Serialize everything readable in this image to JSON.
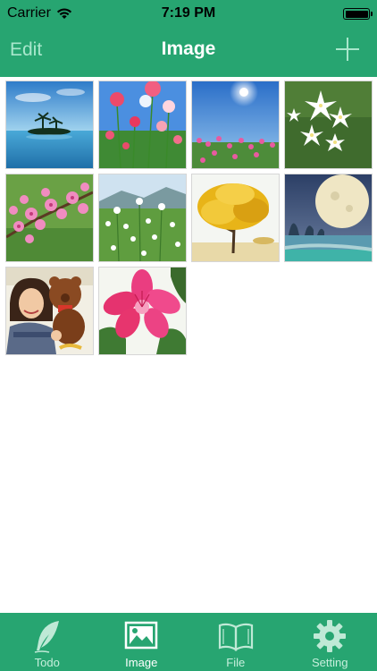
{
  "status_bar": {
    "carrier": "Carrier",
    "time": "7:19 PM"
  },
  "nav": {
    "edit_label": "Edit",
    "title": "Image",
    "add_icon": "plus-icon"
  },
  "images": [
    {
      "subject": "tropical-island"
    },
    {
      "subject": "red-poppies"
    },
    {
      "subject": "sunny-flower-meadow"
    },
    {
      "subject": "white-star-flowers"
    },
    {
      "subject": "peach-blossoms"
    },
    {
      "subject": "white-wildflowers"
    },
    {
      "subject": "golden-tree"
    },
    {
      "subject": "moon-over-sea"
    },
    {
      "subject": "girl-with-teddy-bear"
    },
    {
      "subject": "pink-lily"
    }
  ],
  "tabs": [
    {
      "label": "Todo",
      "icon": "feather-icon",
      "active": false
    },
    {
      "label": "Image",
      "icon": "picture-icon",
      "active": true
    },
    {
      "label": "File",
      "icon": "book-icon",
      "active": false
    },
    {
      "label": "Setting",
      "icon": "gear-icon",
      "active": false
    }
  ],
  "colors": {
    "brand_green": "#27a571",
    "nav_button_tint": "#a8e7cc",
    "tab_inactive_icon": "#bfe9d6"
  }
}
